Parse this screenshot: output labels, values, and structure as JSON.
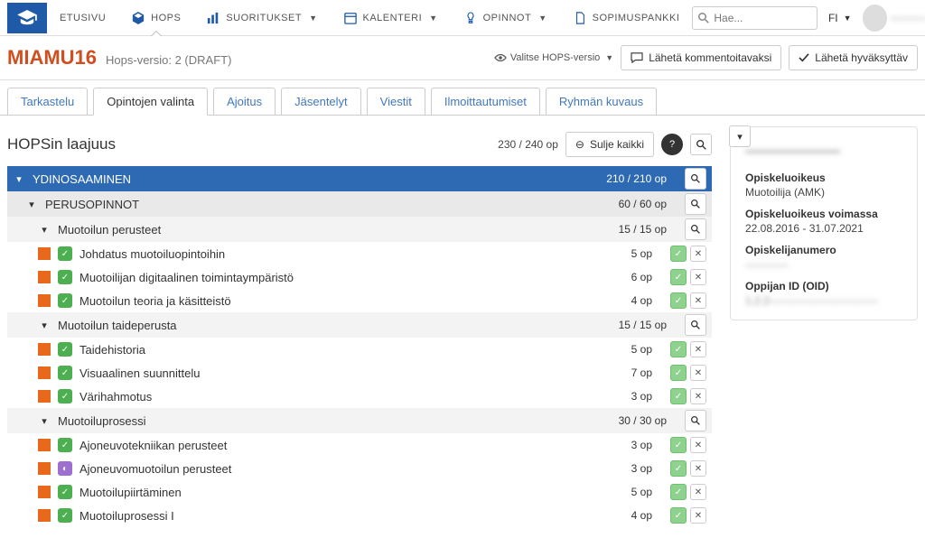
{
  "nav": {
    "home": "ETUSIVU",
    "hops": "HOPS",
    "results": "SUORITUKSET",
    "calendar": "KALENTERI",
    "studies": "OPINNOT",
    "contracts": "SOPIMUSPANKKI",
    "searchPlaceholder": "Hae...",
    "lang": "FI"
  },
  "plan": {
    "code": "MIAMU16",
    "version": "Hops-versio: 2 (DRAFT)",
    "selectVersion": "Valitse HOPS-versio",
    "sendComment": "Lähetä kommentoitavaksi",
    "sendApprove": "Lähetä hyväksyttäv"
  },
  "tabs": {
    "t1": "Tarkastelu",
    "t2": "Opintojen valinta",
    "t3": "Ajoitus",
    "t4": "Jäsentelyt",
    "t5": "Viestit",
    "t6": "Ilmoittautumiset",
    "t7": "Ryhmän kuvaus"
  },
  "scope": {
    "title": "HOPSin laajuus",
    "total": "230 / 240 op",
    "closeAll": "Sulje kaikki"
  },
  "groups": {
    "core": {
      "name": "YDINOSAAMINEN",
      "cred": "210 / 210 op"
    },
    "basic": {
      "name": "PERUSOPINNOT",
      "cred": "60 / 60 op"
    },
    "g1": {
      "name": "Muotoilun perusteet",
      "cred": "15 / 15 op"
    },
    "g2": {
      "name": "Muotoilun taideperusta",
      "cred": "15 / 15 op"
    },
    "g3": {
      "name": "Muotoiluprosessi",
      "cred": "30 / 30 op"
    }
  },
  "courses": {
    "c1": {
      "name": "Johdatus muotoiluopintoihin",
      "cred": "5 op"
    },
    "c2": {
      "name": "Muotoilijan digitaalinen toimintaympäristö",
      "cred": "6 op"
    },
    "c3": {
      "name": "Muotoilun teoria ja käsitteistö",
      "cred": "4 op"
    },
    "c4": {
      "name": "Taidehistoria",
      "cred": "5 op"
    },
    "c5": {
      "name": "Visuaalinen suunnittelu",
      "cred": "7 op"
    },
    "c6": {
      "name": "Värihahmotus",
      "cred": "3 op"
    },
    "c7": {
      "name": "Ajoneuvotekniikan perusteet",
      "cred": "3 op"
    },
    "c8": {
      "name": "Ajoneuvomuotoilun perusteet",
      "cred": "3 op"
    },
    "c9": {
      "name": "Muotoilupiirtäminen",
      "cred": "5 op"
    },
    "c10": {
      "name": "Muotoiluprosessi I",
      "cred": "4 op"
    }
  },
  "side": {
    "name": "———————",
    "rightLbl": "Opiskeluoikeus",
    "rightVal": "Muotoilija (AMK)",
    "validLbl": "Opiskeluoikeus voimassa",
    "validVal": "22.08.2016 - 31.07.2021",
    "numLbl": "Opiskelijanumero",
    "numVal": "————",
    "oidLbl": "Oppijan ID (OID)",
    "oidVal": "1.2.2——————————"
  }
}
